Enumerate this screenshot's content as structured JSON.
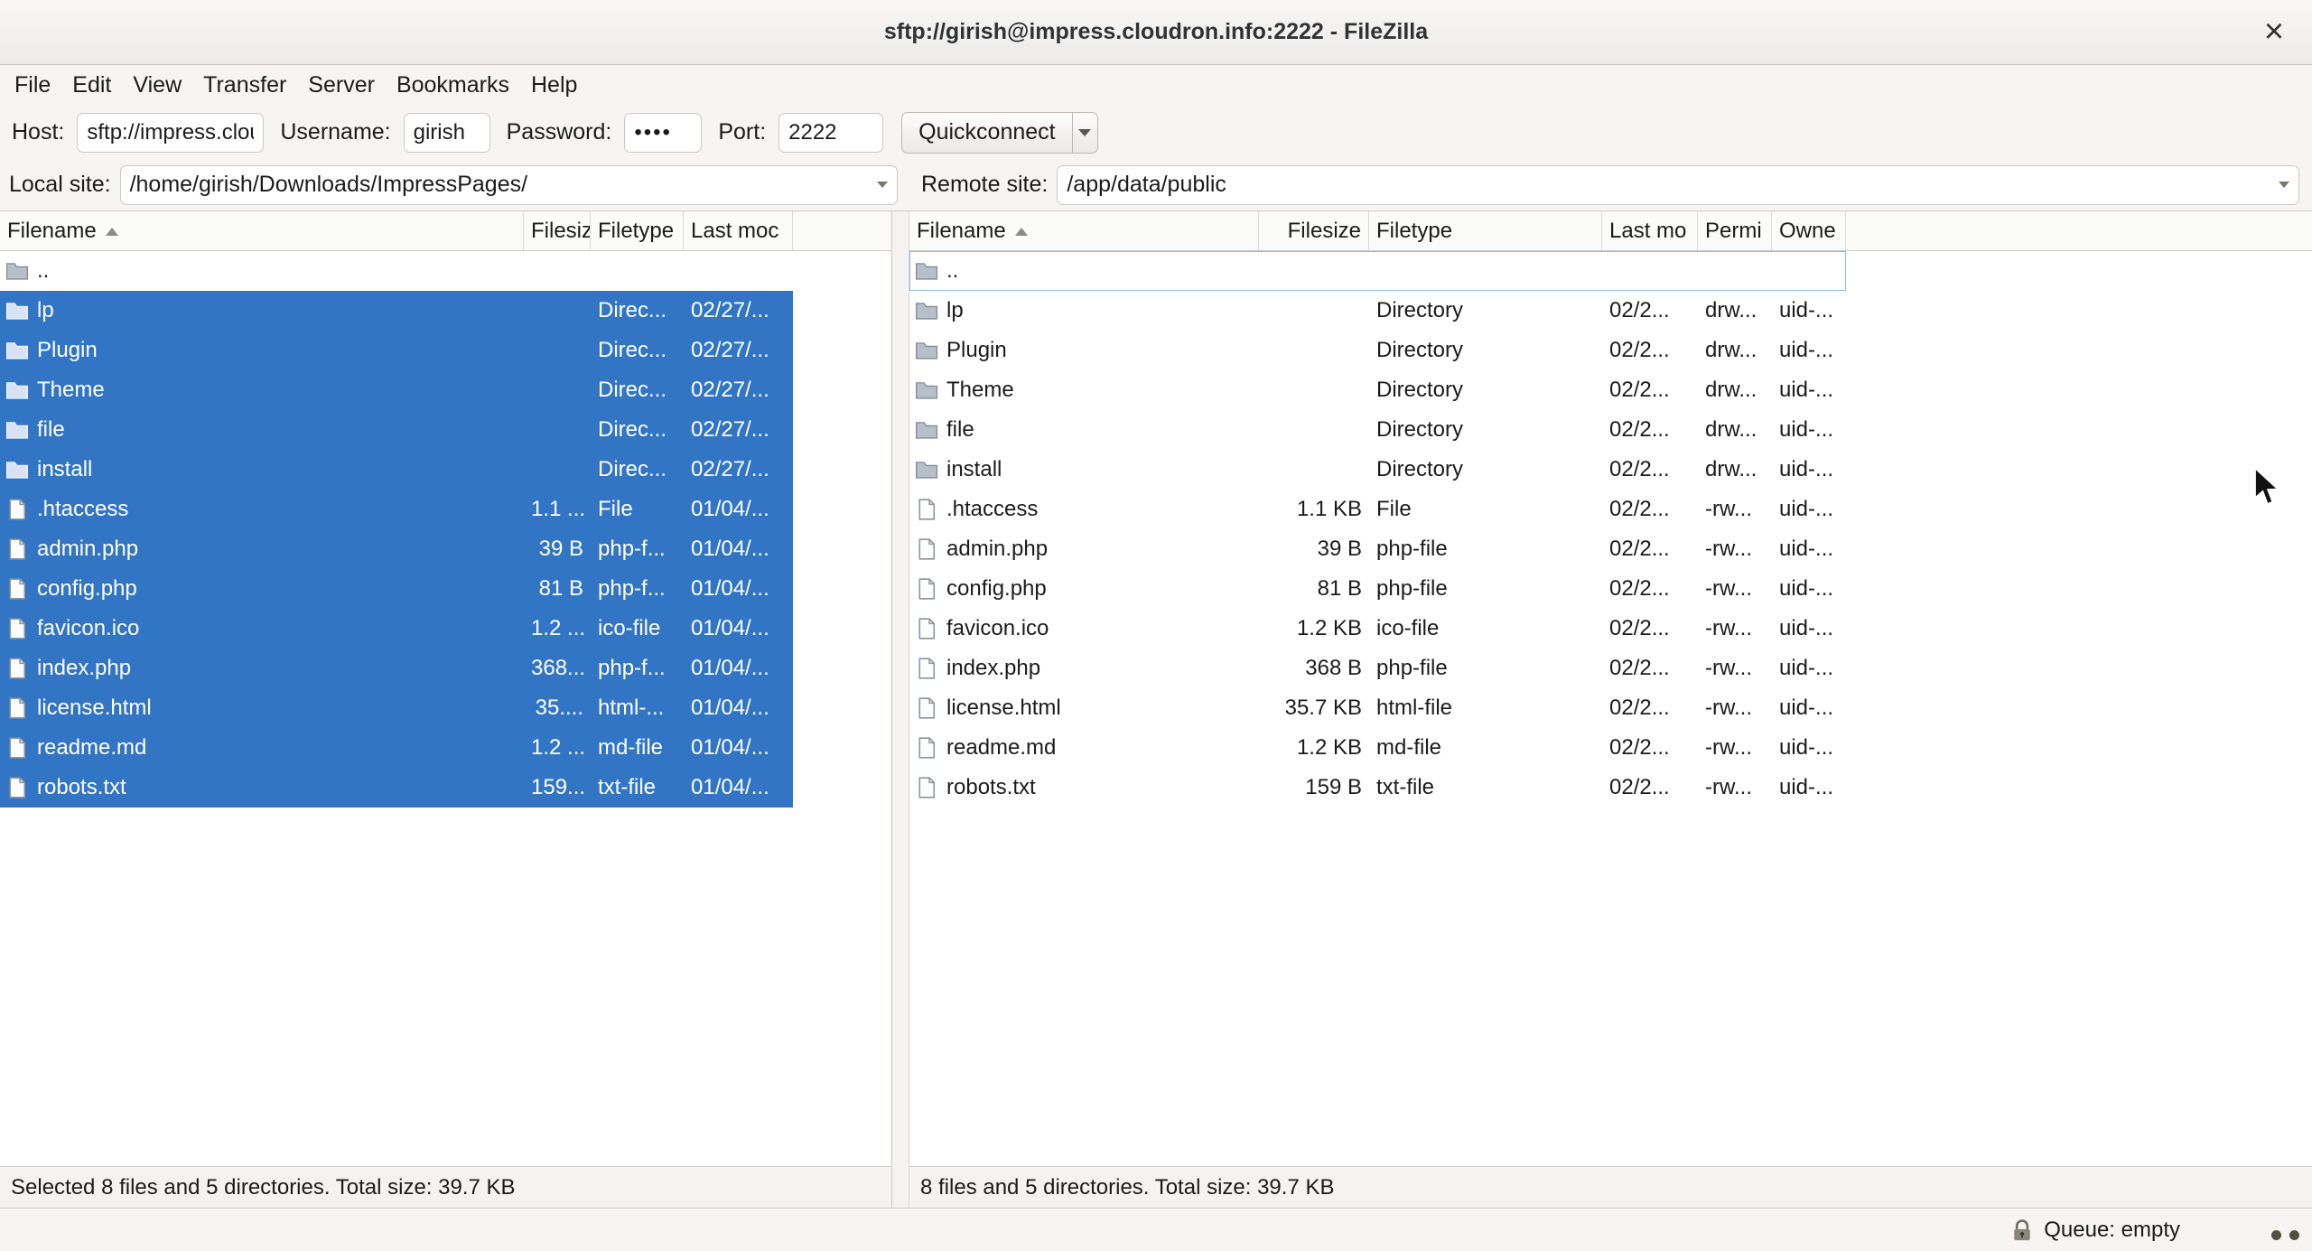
{
  "window": {
    "title": "sftp://girish@impress.cloudron.info:2222 - FileZilla",
    "close_glyph": "×"
  },
  "menubar": {
    "items": [
      "File",
      "Edit",
      "View",
      "Transfer",
      "Server",
      "Bookmarks",
      "Help"
    ]
  },
  "quickconnect": {
    "host_label": "Host:",
    "host_value": "sftp://impress.cloudr",
    "username_label": "Username:",
    "username_value": "girish",
    "password_label": "Password:",
    "password_value": "••••",
    "port_label": "Port:",
    "port_value": "2222",
    "button_label": "Quickconnect"
  },
  "local_panel": {
    "site_label": "Local site:",
    "site_value": "/home/girish/Downloads/ImpressPages/",
    "columns": [
      {
        "label": "Filename",
        "sort": true
      },
      {
        "label": "Filesiz"
      },
      {
        "label": "Filetype"
      },
      {
        "label": "Last moc"
      }
    ],
    "rows": [
      {
        "name": "..",
        "is_dir": true
      },
      {
        "name": "lp",
        "is_dir": true,
        "type": "Direc...",
        "modified": "02/27/...",
        "selected": true
      },
      {
        "name": "Plugin",
        "is_dir": true,
        "type": "Direc...",
        "modified": "02/27/...",
        "selected": true
      },
      {
        "name": "Theme",
        "is_dir": true,
        "type": "Direc...",
        "modified": "02/27/...",
        "selected": true
      },
      {
        "name": "file",
        "is_dir": true,
        "type": "Direc...",
        "modified": "02/27/...",
        "selected": true
      },
      {
        "name": "install",
        "is_dir": true,
        "type": "Direc...",
        "modified": "02/27/...",
        "selected": true
      },
      {
        "name": ".htaccess",
        "size": "1.1 ...",
        "type": "File",
        "modified": "01/04/...",
        "selected": true
      },
      {
        "name": "admin.php",
        "size": "39 B",
        "type": "php-f...",
        "modified": "01/04/...",
        "selected": true
      },
      {
        "name": "config.php",
        "size": "81 B",
        "type": "php-f...",
        "modified": "01/04/...",
        "selected": true
      },
      {
        "name": "favicon.ico",
        "size": "1.2 ...",
        "type": "ico-file",
        "modified": "01/04/...",
        "selected": true
      },
      {
        "name": "index.php",
        "size": "368...",
        "type": "php-f...",
        "modified": "01/04/...",
        "selected": true
      },
      {
        "name": "license.html",
        "size": "35....",
        "type": "html-...",
        "modified": "01/04/...",
        "selected": true
      },
      {
        "name": "readme.md",
        "size": "1.2 ...",
        "type": "md-file",
        "modified": "01/04/...",
        "selected": true
      },
      {
        "name": "robots.txt",
        "size": "159...",
        "type": "txt-file",
        "modified": "01/04/...",
        "selected": true
      }
    ],
    "status": "Selected 8 files and 5 directories. Total size: 39.7 KB"
  },
  "remote_panel": {
    "site_label": "Remote site:",
    "site_value": "/app/data/public",
    "columns": [
      {
        "label": "Filename",
        "sort": true
      },
      {
        "label": "Filesize",
        "right": true
      },
      {
        "label": "Filetype"
      },
      {
        "label": "Last mo"
      },
      {
        "label": "Permi"
      },
      {
        "label": "Owne"
      }
    ],
    "rows": [
      {
        "name": "..",
        "is_dir": true,
        "focused": true
      },
      {
        "name": "lp",
        "is_dir": true,
        "type": "Directory",
        "modified": "02/2...",
        "perms": "drw...",
        "owner": "uid-..."
      },
      {
        "name": "Plugin",
        "is_dir": true,
        "type": "Directory",
        "modified": "02/2...",
        "perms": "drw...",
        "owner": "uid-..."
      },
      {
        "name": "Theme",
        "is_dir": true,
        "type": "Directory",
        "modified": "02/2...",
        "perms": "drw...",
        "owner": "uid-..."
      },
      {
        "name": "file",
        "is_dir": true,
        "type": "Directory",
        "modified": "02/2...",
        "perms": "drw...",
        "owner": "uid-..."
      },
      {
        "name": "install",
        "is_dir": true,
        "type": "Directory",
        "modified": "02/2...",
        "perms": "drw...",
        "owner": "uid-..."
      },
      {
        "name": ".htaccess",
        "size": "1.1 KB",
        "type": "File",
        "modified": "02/2...",
        "perms": "-rw...",
        "owner": "uid-..."
      },
      {
        "name": "admin.php",
        "size": "39 B",
        "type": "php-file",
        "modified": "02/2...",
        "perms": "-rw...",
        "owner": "uid-..."
      },
      {
        "name": "config.php",
        "size": "81 B",
        "type": "php-file",
        "modified": "02/2...",
        "perms": "-rw...",
        "owner": "uid-..."
      },
      {
        "name": "favicon.ico",
        "size": "1.2 KB",
        "type": "ico-file",
        "modified": "02/2...",
        "perms": "-rw...",
        "owner": "uid-..."
      },
      {
        "name": "index.php",
        "size": "368 B",
        "type": "php-file",
        "modified": "02/2...",
        "perms": "-rw...",
        "owner": "uid-..."
      },
      {
        "name": "license.html",
        "size": "35.7 KB",
        "type": "html-file",
        "modified": "02/2...",
        "perms": "-rw...",
        "owner": "uid-..."
      },
      {
        "name": "readme.md",
        "size": "1.2 KB",
        "type": "md-file",
        "modified": "02/2...",
        "perms": "-rw...",
        "owner": "uid-..."
      },
      {
        "name": "robots.txt",
        "size": "159 B",
        "type": "txt-file",
        "modified": "02/2...",
        "perms": "-rw...",
        "owner": "uid-..."
      }
    ],
    "status": "8 files and 5 directories. Total size: 39.7 KB"
  },
  "statusbar": {
    "queue_status": "Queue: empty"
  },
  "colors": {
    "selection": "#3275c4"
  }
}
